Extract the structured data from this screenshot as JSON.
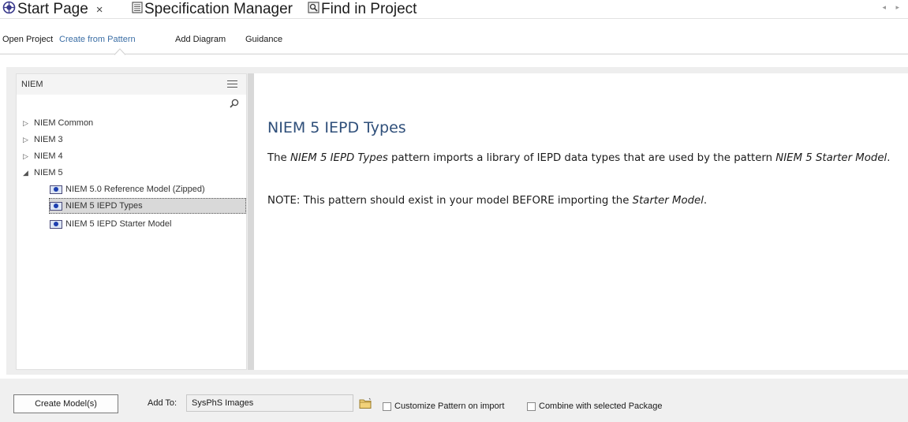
{
  "tabs": [
    {
      "label": "Start Page",
      "icon": "start-page-icon",
      "closable": true,
      "active": true
    },
    {
      "label": "Specification Manager",
      "icon": "specification-manager-icon"
    },
    {
      "label": "Find in Project",
      "icon": "find-in-project-icon"
    }
  ],
  "tab_close_glyph": "×",
  "tab_scroll_glyph": "◂ ▸",
  "subnav": {
    "items": [
      "Open Project",
      "Create from Pattern",
      "Add Diagram",
      "Guidance"
    ],
    "active": "Create from Pattern"
  },
  "left_panel": {
    "title": "NIEM",
    "tree": [
      {
        "label": "NIEM Common",
        "level": 0,
        "state": "collapsed"
      },
      {
        "label": "NIEM 3",
        "level": 0,
        "state": "collapsed"
      },
      {
        "label": "NIEM 4",
        "level": 0,
        "state": "collapsed"
      },
      {
        "label": "NIEM 5",
        "level": 0,
        "state": "expanded"
      },
      {
        "label": "NIEM 5.0 Reference Model (Zipped)",
        "level": 1,
        "icon": "pattern-icon"
      },
      {
        "label": "NIEM 5 IEPD Types",
        "level": 1,
        "icon": "pattern-icon",
        "selected": true
      },
      {
        "label": "NIEM 5 IEPD Starter Model",
        "level": 1,
        "icon": "pattern-icon"
      }
    ]
  },
  "detail": {
    "title": "NIEM 5 IEPD Types",
    "p1": {
      "a": "The ",
      "b": "NIEM 5 IEPD Types",
      "c": " pattern imports a library of IEPD data types that are used by the pattern ",
      "d": "NIEM 5 Starter Model",
      "e": "."
    },
    "p2": {
      "a": "NOTE:  This pattern should exist in your model BEFORE importing the ",
      "b": "Starter Model",
      "c": "."
    }
  },
  "footer": {
    "create_button": "Create Model(s)",
    "add_to_label": "Add To:",
    "add_to_value": "SysPhS Images",
    "customize_label": "Customize Pattern on import",
    "customize_checked": false,
    "combine_label": "Combine with selected Package",
    "combine_checked": false
  },
  "colors": {
    "heading": "#2f4f7a",
    "active_link": "#3b6ea5",
    "selection": "#d9d9d9",
    "pattern_icon_fill": "#1d3fb0"
  }
}
